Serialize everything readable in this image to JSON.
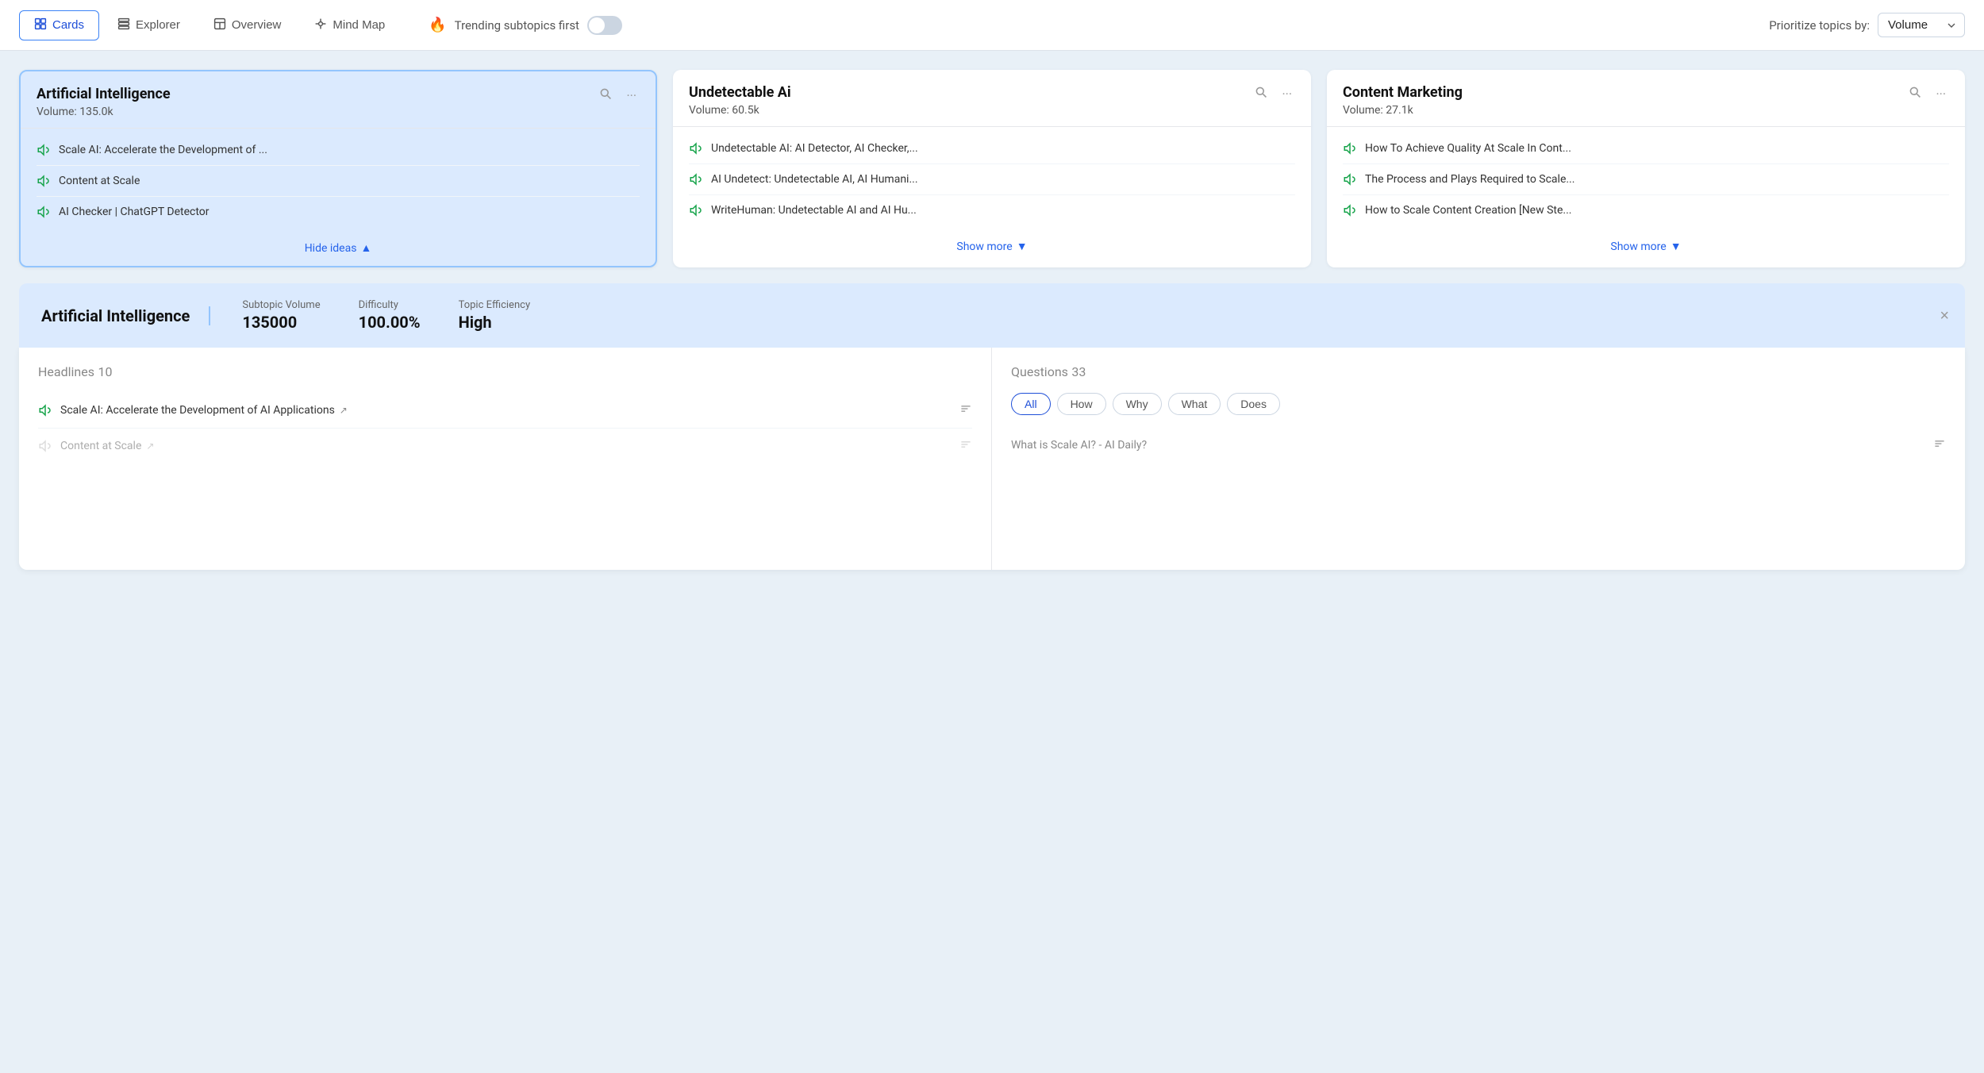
{
  "nav": {
    "tabs": [
      {
        "id": "cards",
        "label": "Cards",
        "icon": "⊞",
        "active": true
      },
      {
        "id": "explorer",
        "label": "Explorer",
        "icon": "⊟",
        "active": false
      },
      {
        "id": "overview",
        "label": "Overview",
        "icon": "⊡",
        "active": false
      },
      {
        "id": "mindmap",
        "label": "Mind Map",
        "icon": "⊞",
        "active": false
      }
    ],
    "trending_label": "Trending subtopics first",
    "prioritize_label": "Prioritize topics by:",
    "prioritize_value": "Volume"
  },
  "cards": [
    {
      "id": "artificial-intelligence",
      "title": "Artificial Intelligence",
      "volume_label": "Volume:",
      "volume": "135.0k",
      "active": true,
      "items": [
        "Scale AI: Accelerate the Development of ...",
        "Content at Scale",
        "AI Checker | ChatGPT Detector"
      ],
      "footer_label": "Hide ideas",
      "footer_expanded": true
    },
    {
      "id": "undetectable-ai",
      "title": "Undetectable Ai",
      "volume_label": "Volume:",
      "volume": "60.5k",
      "active": false,
      "items": [
        "Undetectable AI: AI Detector, AI Checker,...",
        "AI Undetect: Undetectable AI, AI Humani...",
        "WriteHuman: Undetectable AI and AI Hu..."
      ],
      "footer_label": "Show more",
      "footer_expanded": false
    },
    {
      "id": "content-marketing",
      "title": "Content Marketing",
      "volume_label": "Volume:",
      "volume": "27.1k",
      "active": false,
      "items": [
        "How To Achieve Quality At Scale In Cont...",
        "The Process and Plays Required to Scale...",
        "How to Scale Content Creation [New Ste..."
      ],
      "footer_label": "Show more",
      "footer_expanded": false
    }
  ],
  "detail": {
    "topic_name": "Artificial Intelligence",
    "stats": [
      {
        "label": "Subtopic Volume",
        "value": "135000"
      },
      {
        "label": "Difficulty",
        "value": "100.00%"
      },
      {
        "label": "Topic Efficiency",
        "value": "High"
      }
    ]
  },
  "headlines": {
    "title": "Headlines",
    "count": "10",
    "items": [
      {
        "text": "Scale AI: Accelerate the Development of AI Applications",
        "has_link": true,
        "enabled": true
      },
      {
        "text": "Content at Scale",
        "has_link": true,
        "enabled": false
      }
    ]
  },
  "questions": {
    "title": "Questions",
    "count": "33",
    "filters": [
      {
        "label": "All",
        "active": true
      },
      {
        "label": "How",
        "active": false
      },
      {
        "label": "Why",
        "active": false
      },
      {
        "label": "What",
        "active": false
      },
      {
        "label": "Does",
        "active": false
      }
    ],
    "items": [
      {
        "text": "What is Scale AI? - AI Daily?",
        "enabled": false
      }
    ]
  }
}
